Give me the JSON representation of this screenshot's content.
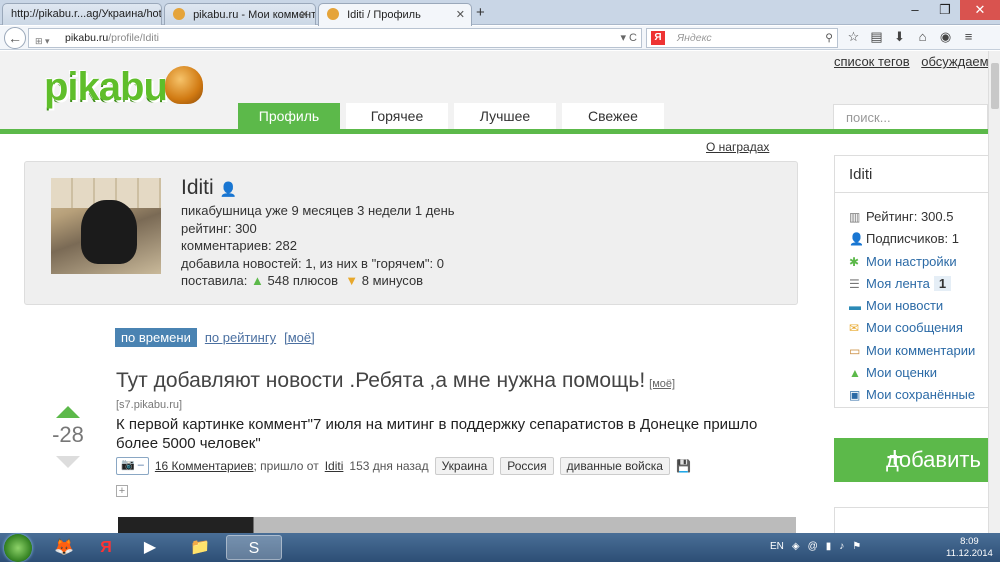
{
  "browser": {
    "tabs": [
      {
        "label": "http://pikabu.r...ag/Украина/hot",
        "active": false
      },
      {
        "label": "pikabu.ru - Мои коммент...",
        "active": false
      },
      {
        "label": "Iditi / Профиль",
        "active": true
      }
    ],
    "url_domain": "pikabu.ru",
    "url_path": "/profile/Iditi",
    "search_placeholder": "Яндекс"
  },
  "header": {
    "logo": "pikabu",
    "top_links": [
      "список тегов",
      "обсуждаем"
    ],
    "nav_tabs": [
      "Профиль",
      "Горячее",
      "Лучшее",
      "Свежее"
    ],
    "search_placeholder": "поиск..."
  },
  "profile": {
    "awards_link": "О наградах",
    "name": "Iditi",
    "line1": "пикабушница уже 9 месяцев 3 недели 1 день",
    "rating": "рейтинг: 300",
    "comments": "комментариев: 282",
    "news": "добавила новостей: 1, из них в \"горячем\": 0",
    "gave_prefix": "поставила:",
    "pluses": "548 плюсов",
    "minuses": "8 минусов"
  },
  "sort": {
    "active": "по времени",
    "rating": "по рейтингу",
    "mine": "[моё]"
  },
  "story": {
    "title": "Тут добавляют новости .Ребята ,а мне нужна помощь!",
    "mine_tag": "[моё]",
    "score": "-28",
    "source": "[s7.pikabu.ru]",
    "text": "К первой картинке коммент\"7 июля на митинг в поддержку сепаратистов в Донецке пришло более 5000 человек\"",
    "camera_label": "📷 –",
    "comments_link": "16 Комментариев",
    "came_from": "; пришло от",
    "author": "Iditi",
    "ago": "153 дня назад",
    "tags": [
      "Украина",
      "Россия",
      "диванные войска"
    ]
  },
  "sidebar": {
    "name": "Iditi",
    "rating": "Рейтинг: 300.5",
    "subscribers": "Подписчиков: 1",
    "links": [
      "Мои настройки",
      "Моя лента",
      "Мои новости",
      "Мои сообщения",
      "Мои комментарии",
      "Мои оценки",
      "Мои сохранённые"
    ],
    "feed_count": "1",
    "add_button": "добавить"
  },
  "taskbar": {
    "lang": "EN",
    "time": "8:09",
    "date": "11.12.2014"
  },
  "colors": {
    "brand_green": "#5cb94a",
    "link_blue": "#2b6aa6",
    "sort_blue": "#4a83b2"
  }
}
